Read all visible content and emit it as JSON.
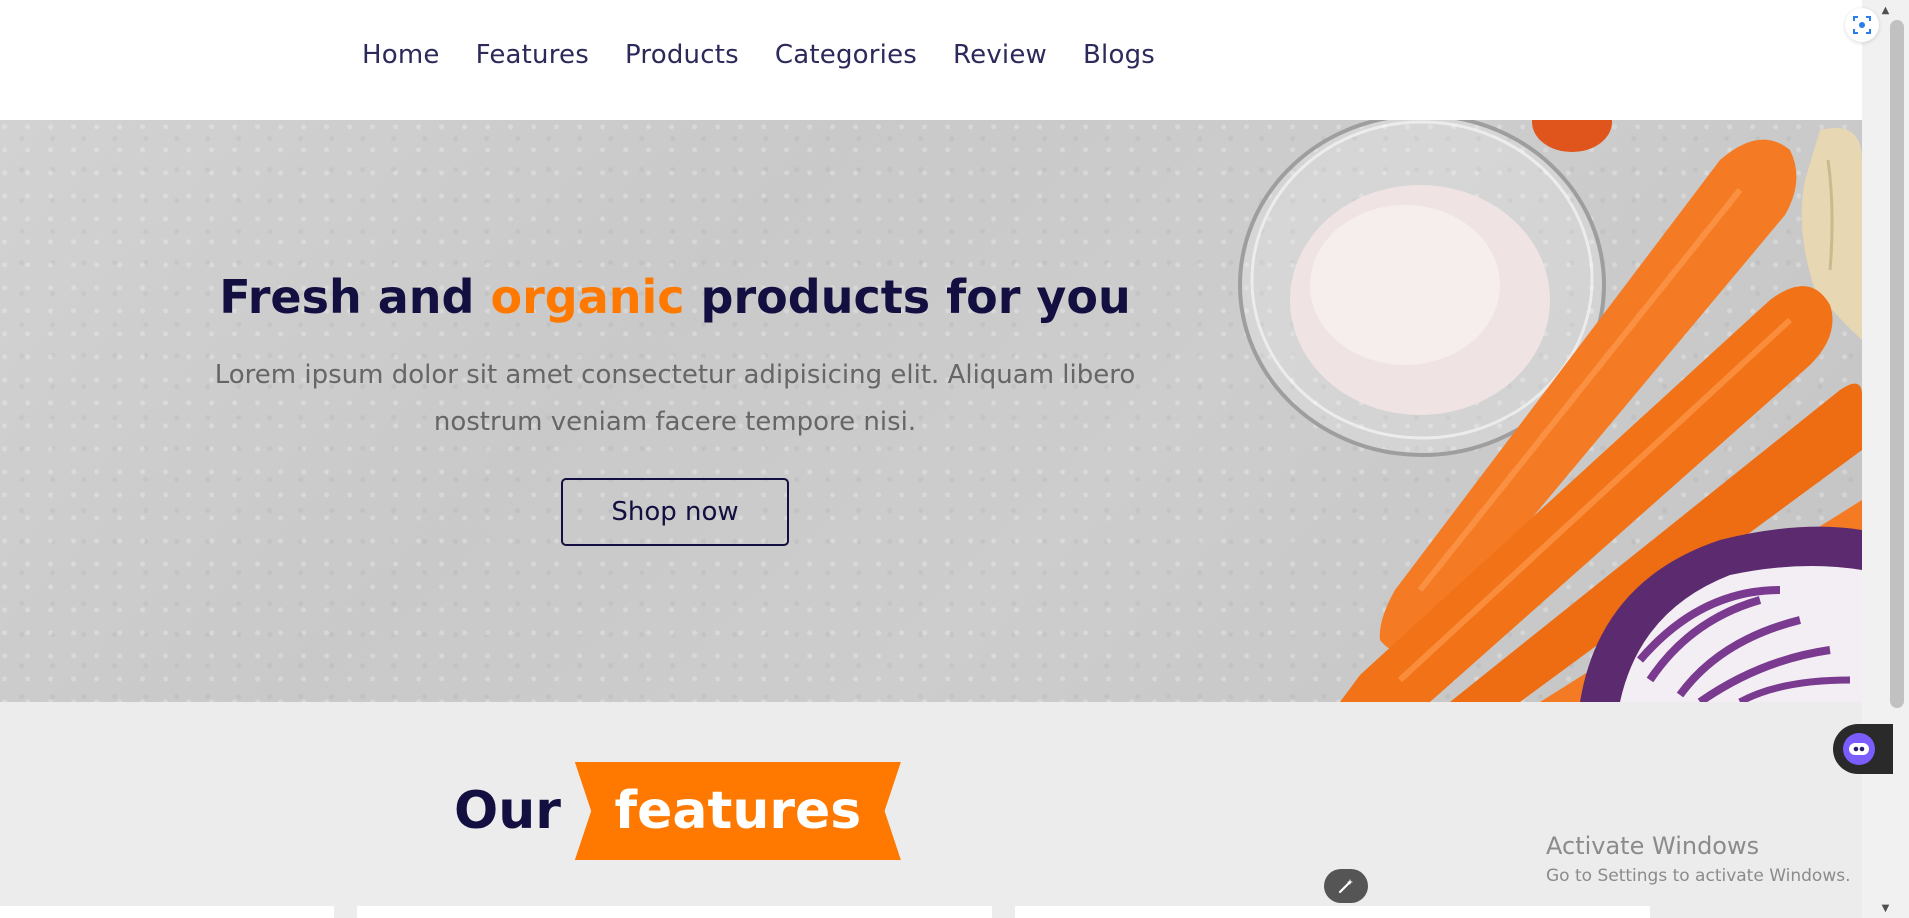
{
  "nav": {
    "items": [
      {
        "label": "Home"
      },
      {
        "label": "Features"
      },
      {
        "label": "Products"
      },
      {
        "label": "Categories"
      },
      {
        "label": "Review"
      },
      {
        "label": "Blogs"
      }
    ]
  },
  "hero": {
    "title_part1": "Fresh and ",
    "title_accent": "organic",
    "title_part2": " products for you",
    "description": "Lorem ipsum dolor sit amet consectetur adipisicing elit. Aliquam libero nostrum veniam facere tempore nisi.",
    "button_label": "Shop now"
  },
  "features": {
    "heading_plain": "Our",
    "heading_accent": "features"
  },
  "system": {
    "activate_title": "Activate Windows",
    "activate_subtitle": "Go to Settings to activate Windows."
  },
  "colors": {
    "accent": "#ff7800",
    "dark": "#130f40",
    "text_gray": "#666666",
    "section_bg": "#ececec"
  },
  "icons": {
    "lens": "visual-search-icon",
    "assistant": "assistant-bot-icon",
    "magic": "magic-wand-icon"
  }
}
